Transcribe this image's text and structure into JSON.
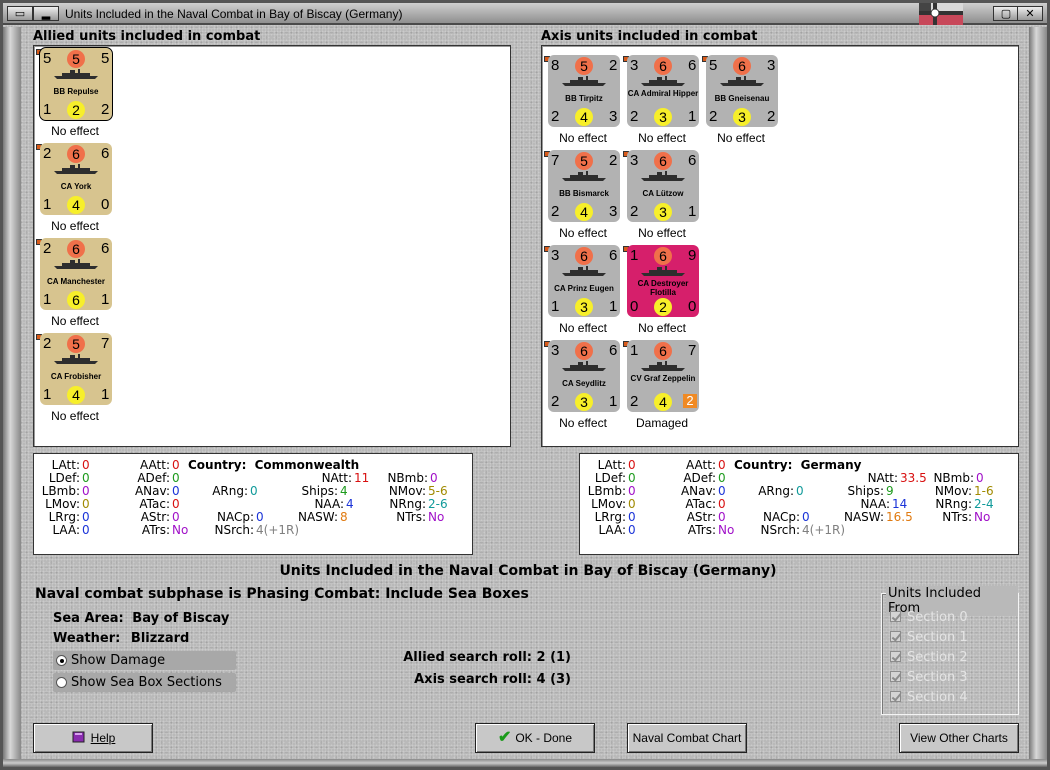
{
  "window": {
    "title": "Units Included in the Naval Combat in Bay of Biscay (Germany)"
  },
  "allied": {
    "heading": "Allied units included in combat",
    "units": [
      {
        "name": "BB Repulse",
        "tl": "5",
        "tc": "5",
        "tr": "5",
        "bl": "1",
        "bc": "2",
        "br": "2",
        "status": "No effect",
        "color": "tan"
      },
      {
        "name": "CA York",
        "tl": "2",
        "tc": "6",
        "tr": "6",
        "bl": "1",
        "bc": "4",
        "br": "0",
        "status": "No effect",
        "color": "tan"
      },
      {
        "name": "CA Manchester",
        "tl": "2",
        "tc": "6",
        "tr": "6",
        "bl": "1",
        "bc": "6",
        "br": "1",
        "status": "No effect",
        "color": "tan"
      },
      {
        "name": "CA Frobisher",
        "tl": "2",
        "tc": "5",
        "tr": "7",
        "bl": "1",
        "bc": "4",
        "br": "1",
        "status": "No effect",
        "color": "tan"
      }
    ]
  },
  "axis": {
    "heading": "Axis units included in combat",
    "units": [
      {
        "name": "BB Tirpitz",
        "tl": "8",
        "tc": "5",
        "tr": "2",
        "bl": "2",
        "bc": "4",
        "br": "3",
        "status": "No effect",
        "color": "grey"
      },
      {
        "name": "CA Admiral Hipper",
        "tl": "3",
        "tc": "6",
        "tr": "6",
        "bl": "2",
        "bc": "3",
        "br": "1",
        "status": "No effect",
        "color": "grey"
      },
      {
        "name": "BB Gneisenau",
        "tl": "5",
        "tc": "6",
        "tr": "3",
        "bl": "2",
        "bc": "3",
        "br": "2",
        "status": "No effect",
        "color": "grey"
      },
      {
        "name": "BB Bismarck",
        "tl": "7",
        "tc": "5",
        "tr": "2",
        "bl": "2",
        "bc": "4",
        "br": "3",
        "status": "No effect",
        "color": "grey"
      },
      {
        "name": "CA Lützow",
        "tl": "3",
        "tc": "6",
        "tr": "6",
        "bl": "2",
        "bc": "3",
        "br": "1",
        "status": "No effect",
        "color": "grey"
      },
      {
        "name": "CA Prinz Eugen",
        "tl": "3",
        "tc": "6",
        "tr": "6",
        "bl": "1",
        "bc": "3",
        "br": "1",
        "status": "No effect",
        "color": "grey"
      },
      {
        "name": "CA Destroyer Flotilla",
        "tl": "1",
        "tc": "6",
        "tr": "9",
        "bl": "0",
        "bc": "2",
        "br": "0",
        "status": "No effect",
        "color": "magenta"
      },
      {
        "name": "CA Seydlitz",
        "tl": "3",
        "tc": "6",
        "tr": "6",
        "bl": "2",
        "bc": "3",
        "br": "1",
        "status": "No effect",
        "color": "grey"
      },
      {
        "name": "CV Graf Zeppelin",
        "tl": "1",
        "tc": "6",
        "tr": "7",
        "bl": "2",
        "bc": "4",
        "br": "2",
        "status": "Damaged",
        "color": "grey"
      }
    ]
  },
  "allied_stats": {
    "country_label": "Country:",
    "country": "Commonwealth",
    "LAtt": "0",
    "LDef": "0",
    "LBmb": "0",
    "LMov": "0",
    "LRrg": "0",
    "LAA": "0",
    "AAtt": "0",
    "ADef": "0",
    "ANav": "0",
    "ATac": "0",
    "AStr": "0",
    "ATrs": "No",
    "ARng": "0",
    "NACp": "0",
    "NSrch": "4(+1R)",
    "NAtt": "11",
    "Ships": "4",
    "NAA": "4",
    "NASW": "8",
    "NBmb": "0",
    "NMov": "5-6",
    "NRng": "2-6",
    "NTrs": "No"
  },
  "axis_stats": {
    "country_label": "Country:",
    "country": "Germany",
    "LAtt": "0",
    "LDef": "0",
    "LBmb": "0",
    "LMov": "0",
    "LRrg": "0",
    "LAA": "0",
    "AAtt": "0",
    "ADef": "0",
    "ANav": "0",
    "ATac": "0",
    "AStr": "0",
    "ATrs": "No",
    "ARng": "0",
    "NACp": "0",
    "NSrch": "4(+1R)",
    "NAtt": "33.5",
    "Ships": "9",
    "NAA": "14",
    "NASW": "16.5",
    "NBmb": "0",
    "NMov": "1-6",
    "NRng": "2-4",
    "NTrs": "No"
  },
  "labels": {
    "LAtt": "LAtt:",
    "LDef": "LDef:",
    "LBmb": "LBmb:",
    "LMov": "LMov:",
    "LRrg": "LRrg:",
    "LAA": "LAA:",
    "AAtt": "AAtt:",
    "ADef": "ADef:",
    "ANav": "ANav:",
    "ATac": "ATac:",
    "AStr": "AStr:",
    "ATrs": "ATrs:",
    "ARng": "ARng:",
    "NACp": "NACp:",
    "NSrch": "NSrch:",
    "NAtt": "NAtt:",
    "Ships": "Ships:",
    "NAA": "NAA:",
    "NASW": "NASW:",
    "NBmb": "NBmb:",
    "NMov": "NMov:",
    "NRng": "NRng:",
    "NTrs": "NTrs:"
  },
  "info": {
    "title": "Units Included in the Naval Combat in Bay of Biscay (Germany)",
    "subphase": "Naval combat subphase is Phasing Combat: Include Sea Boxes",
    "sea_area_label": "Sea Area:",
    "sea_area": "Bay of Biscay",
    "weather_label": "Weather:",
    "weather": "Blizzard",
    "show_damage": "Show Damage",
    "show_sea_box": "Show Sea Box Sections",
    "allied_search": "Allied search roll: 2 (1)",
    "axis_search": "Axis search roll: 4 (3)"
  },
  "sections": {
    "legend": "Units Included From",
    "items": [
      "Section 0",
      "Section 1",
      "Section 2",
      "Section 3",
      "Section 4"
    ]
  },
  "buttons": {
    "help": "Help",
    "ok": "OK - Done",
    "naval_chart": "Naval Combat Chart",
    "other_charts": "View Other Charts"
  }
}
